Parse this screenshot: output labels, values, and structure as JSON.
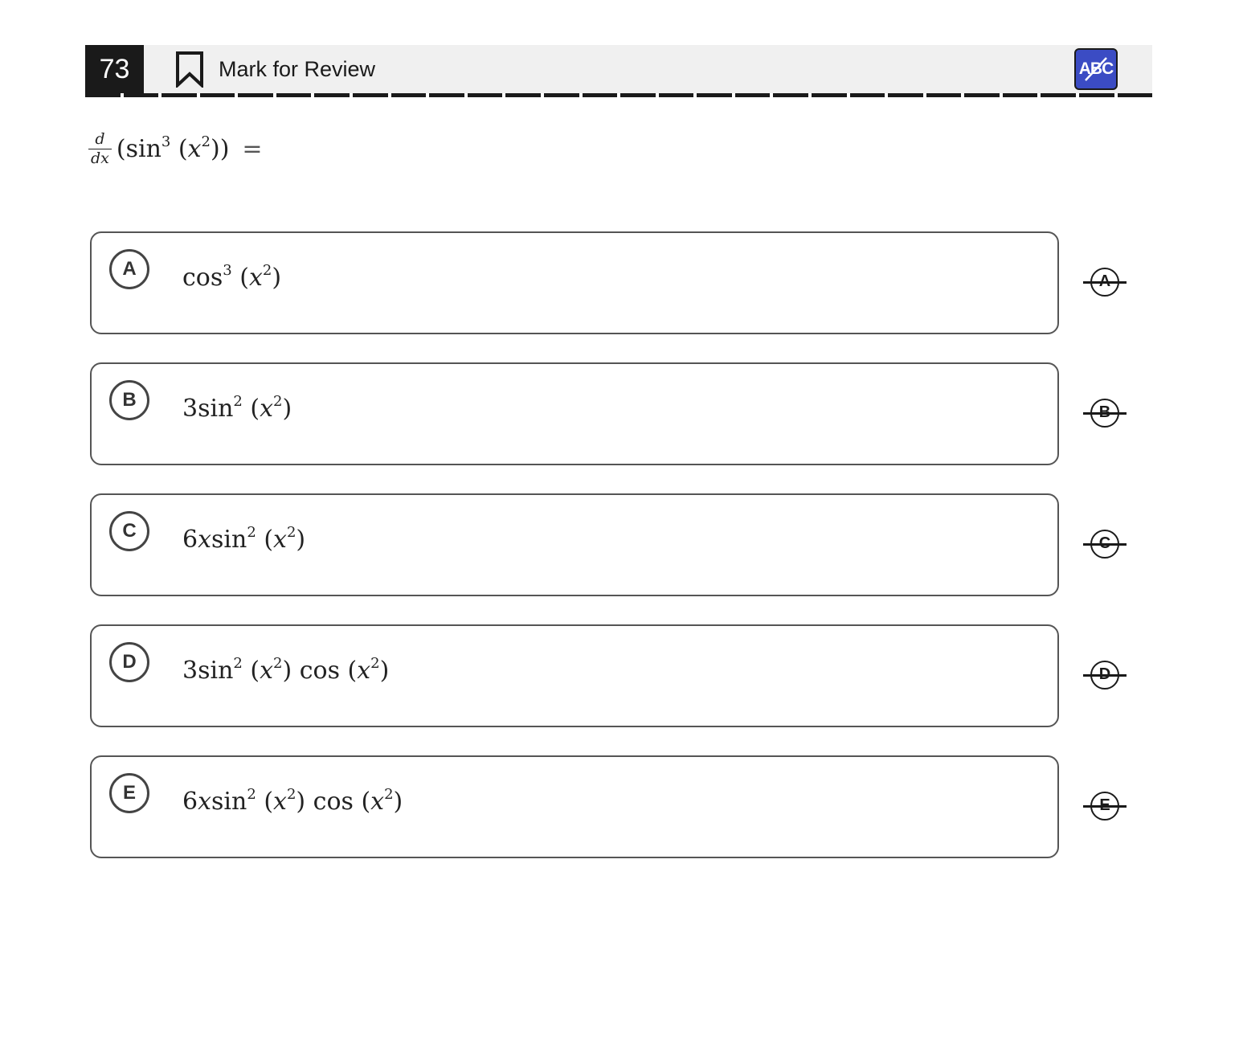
{
  "header": {
    "question_number": "73",
    "mark_for_review_label": "Mark for Review",
    "abc_button_label": "ABC",
    "accent_color": "#3b4cc4"
  },
  "question": {
    "lhs_num": "d",
    "lhs_den": "dx",
    "body_pre": "(sin",
    "body_exp": "3",
    "body_mid": " (",
    "body_var": "x",
    "body_var_exp": "2",
    "body_post": "))",
    "equals": "="
  },
  "options": [
    {
      "letter": "A",
      "pre": "cos",
      "exp": "3",
      "mid": " (",
      "var": "x",
      "var_exp": "2",
      "post": ")"
    },
    {
      "letter": "B",
      "pre": "3sin",
      "exp": "2",
      "mid": " (",
      "var": "x",
      "var_exp": "2",
      "post": ")"
    },
    {
      "letter": "C",
      "pre": "6",
      "pre_var": "x",
      "pre2": "sin",
      "exp": "2",
      "mid": " (",
      "var": "x",
      "var_exp": "2",
      "post": ")"
    },
    {
      "letter": "D",
      "pre": "3sin",
      "exp": "2",
      "mid": " (",
      "var": "x",
      "var_exp": "2",
      "post": ") cos (",
      "var2": "x",
      "var2_exp": "2",
      "post2": ")"
    },
    {
      "letter": "E",
      "pre": "6",
      "pre_var": "x",
      "pre2": "sin",
      "exp": "2",
      "mid": " (",
      "var": "x",
      "var_exp": "2",
      "post": ") cos (",
      "var2": "x",
      "var2_exp": "2",
      "post2": ")"
    }
  ]
}
